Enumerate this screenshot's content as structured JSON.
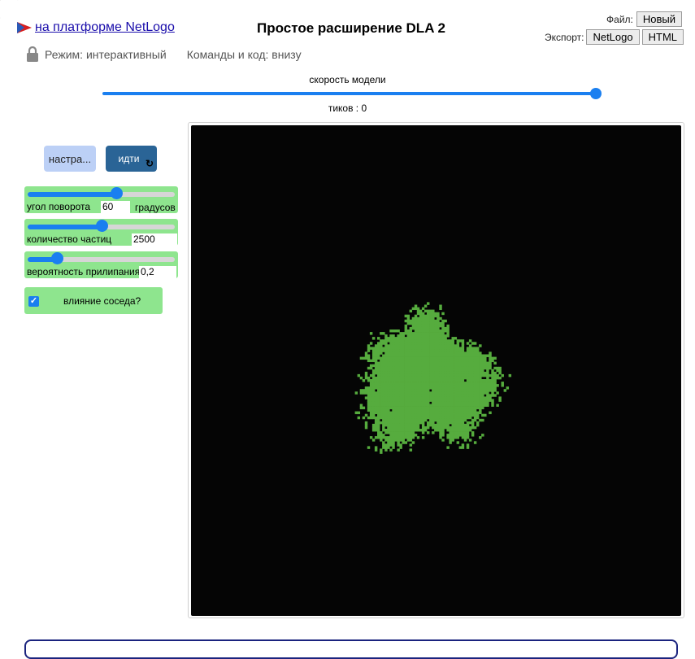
{
  "header": {
    "link_text": "на платформе NetLogo",
    "title": "Простое расширение DLA 2",
    "file_label": "Файл:",
    "new_button": "Новый",
    "export_label": "Экспорт:",
    "export_netlogo": "NetLogo",
    "export_html": "HTML"
  },
  "mode": {
    "mode_text": "Режим: интерактивный",
    "commands_text": "Команды и код: внизу"
  },
  "speed": {
    "label": "скорость модели",
    "value": 1.0
  },
  "ticks": {
    "text": "тиков : 0"
  },
  "buttons": {
    "setup": "настра...",
    "go": "идти",
    "go_icon": "forever-refresh-icon"
  },
  "sliders": [
    {
      "label": "угол поворота",
      "value": "60",
      "units": "градусов",
      "fraction": 0.6
    },
    {
      "label": "количество частиц",
      "value": "2500",
      "units": "",
      "fraction": 0.5
    },
    {
      "label": "вероятность прилипания",
      "value": "0,2",
      "units": "",
      "fraction": 0.2
    }
  ],
  "switch": {
    "label": "влияние соседа?",
    "checked": true
  },
  "view": {
    "background": "#050505",
    "cluster_color": "#56ac3e"
  },
  "colors": {
    "accent": "#1a7ff0",
    "widget_green": "#8ee58e",
    "go_blue": "#2a6496",
    "setup_blue": "#bcd0f6"
  }
}
